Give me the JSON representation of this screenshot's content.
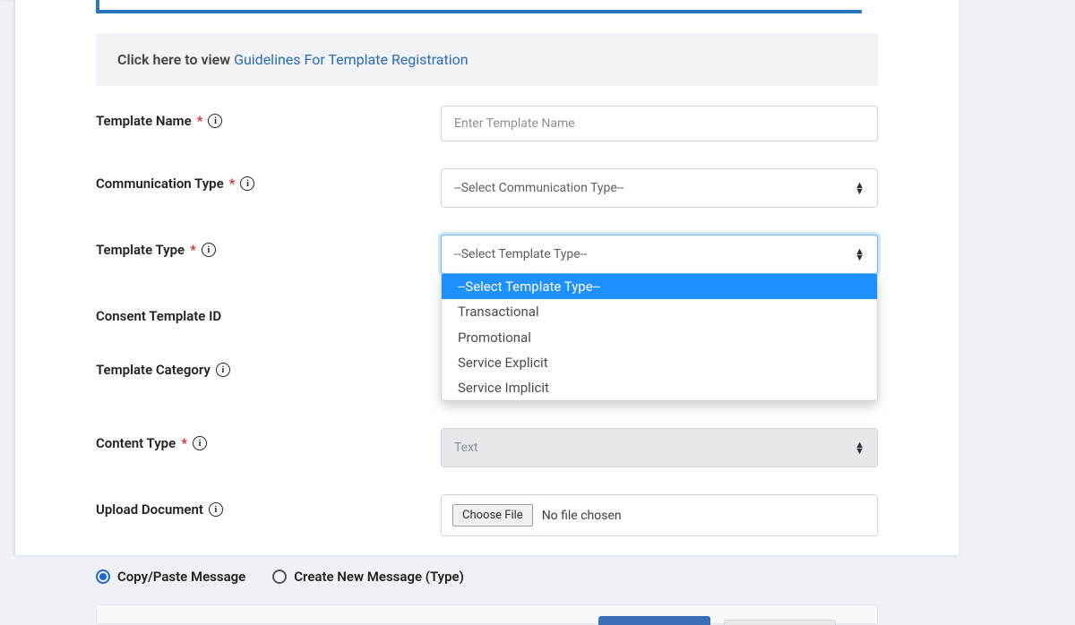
{
  "guidelines": {
    "prefix": "Click here to view ",
    "link_text": "Guidelines For Template Registration"
  },
  "labels": {
    "template_name": "Template Name",
    "communication_type": "Communication Type",
    "template_type": "Template Type",
    "consent_template_id": "Consent Template ID",
    "template_category": "Template Category",
    "content_type": "Content Type",
    "upload_document": "Upload Document"
  },
  "fields": {
    "template_name_placeholder": "Enter Template Name",
    "communication_type_value": "--Select Communication Type--",
    "template_type_value": "--Select Template Type--",
    "template_type_options": {
      "placeholder": "--Select Template Type--",
      "o1": "Transactional",
      "o2": "Promotional",
      "o3": "Service Explicit",
      "o4": "Service Implicit"
    },
    "content_type_value": "Text",
    "upload": {
      "button": "Choose File",
      "status": "No file chosen"
    }
  },
  "radios": {
    "copy_paste": "Copy/Paste Message",
    "create_new": "Create New Message (Type)"
  }
}
